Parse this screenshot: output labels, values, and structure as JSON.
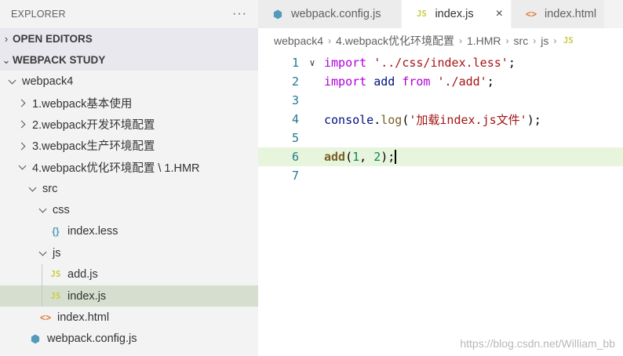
{
  "explorer": {
    "title": "EXPLORER",
    "more": "···",
    "open_editors": "OPEN EDITORS",
    "workspace": "WEBPACK STUDY",
    "tree": [
      {
        "label": "webpack4",
        "indent": 0,
        "type": "folder",
        "open": true
      },
      {
        "label": "1.webpack基本使用",
        "indent": 1,
        "type": "folder",
        "open": false
      },
      {
        "label": "2.webpack开发环境配置",
        "indent": 1,
        "type": "folder",
        "open": false
      },
      {
        "label": "3.webpack生产环境配置",
        "indent": 1,
        "type": "folder",
        "open": false
      },
      {
        "label": "4.webpack优化环境配置 \\ 1.HMR",
        "indent": 1,
        "type": "folder",
        "open": true
      },
      {
        "label": "src",
        "indent": 2,
        "type": "folder",
        "open": true
      },
      {
        "label": "css",
        "indent": 3,
        "type": "folder",
        "open": true
      },
      {
        "label": "index.less",
        "indent": 4,
        "type": "less"
      },
      {
        "label": "js",
        "indent": 3,
        "type": "folder",
        "open": true
      },
      {
        "label": "add.js",
        "indent": 4,
        "type": "js"
      },
      {
        "label": "index.js",
        "indent": 4,
        "type": "js",
        "selected": true
      },
      {
        "label": "index.html",
        "indent": 3,
        "type": "html"
      },
      {
        "label": "webpack.config.js",
        "indent": 2,
        "type": "cfg"
      }
    ]
  },
  "icons": {
    "js": "JS",
    "less": "{}",
    "html": "<>",
    "cfg": "⬢"
  },
  "tabs": [
    {
      "label": "webpack.config.js",
      "icon": "cfg",
      "active": false
    },
    {
      "label": "index.js",
      "icon": "js",
      "active": true,
      "close": "×"
    },
    {
      "label": "index.html",
      "icon": "html",
      "active": false
    }
  ],
  "breadcrumb": [
    "webpack4",
    "4.webpack优化环境配置",
    "1.HMR",
    "src",
    "js",
    "JS"
  ],
  "code": {
    "line_numbers": [
      "1",
      "2",
      "3",
      "4",
      "5",
      "6",
      "7"
    ],
    "l1": {
      "kw": "import",
      "str": "'../css/index.less'",
      "end": ";"
    },
    "l2": {
      "kw": "import",
      "name": "add",
      "from": "from",
      "str": "'./add'",
      "end": ";"
    },
    "l4": {
      "obj": "console",
      "dot": ".",
      "fn": "log",
      "open": "(",
      "str": "'加载index.js文件'",
      "close": ");"
    },
    "l6": {
      "fn": "add",
      "open": "(",
      "a": "1",
      "comma": ", ",
      "b": "2",
      "close": ");"
    }
  },
  "watermark": "https://blog.csdn.net/William_bb",
  "colors": {
    "selection": "#d6dfcf",
    "current_line": "#e8f5dd",
    "keyword": "#0000ff",
    "string": "#a31515"
  }
}
